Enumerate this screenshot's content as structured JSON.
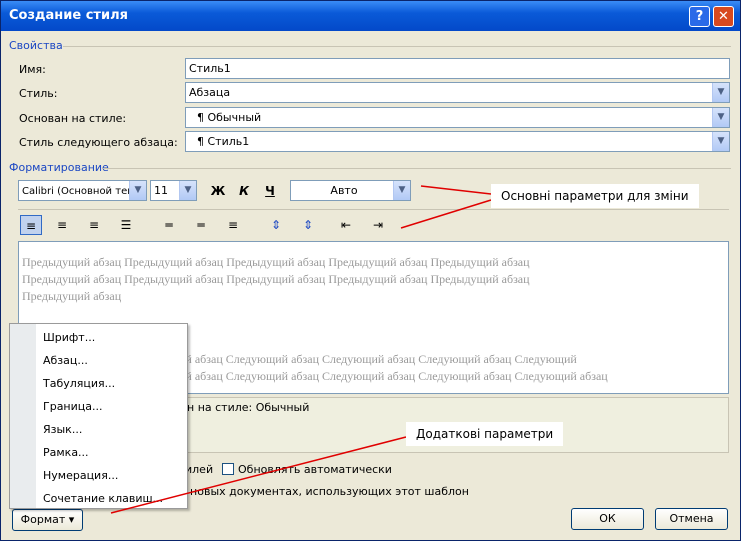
{
  "window": {
    "title": "Создание стиля",
    "help_btn": "?",
    "close_btn": "✕"
  },
  "properties": {
    "section": "Свойства",
    "name_label": "Имя:",
    "name_value": "Стиль1",
    "type_label": "Стиль:",
    "type_value": "Абзаца",
    "based_label": "Основан на стиле:",
    "based_value": "¶ Обычный",
    "next_label": "Стиль следующего абзаца:",
    "next_value": "¶ Стиль1"
  },
  "formatting": {
    "section": "Форматирование",
    "font": "Calibri (Основной текс",
    "size": "11",
    "bold": "Ж",
    "italic": "К",
    "underline": "Ч",
    "color": "Авто"
  },
  "preview": {
    "prev_line1": "Предыдущий абзац Предыдущий абзац Предыдущий абзац Предыдущий абзац Предыдущий абзац",
    "prev_line2": "Предыдущий абзац Предыдущий абзац Предыдущий абзац Предыдущий абзац Предыдущий абзац",
    "prev_line3": "Предыдущий абзац",
    "next_line1": "ий абзац Следующий абзац Следующий абзац Следующий абзац Следующий",
    "next_line2": "ий абзац Следующий абзац Следующий абзац Следующий абзац Следующий абзац"
  },
  "description": {
    "text": "н на стиле: Обычный"
  },
  "options": {
    "add_styles_partial": "илей",
    "auto_update": "Обновлять автоматически",
    "new_docs": "В новых документах, использующих этот шаблон"
  },
  "menu": {
    "items": [
      "Шрифт...",
      "Абзац...",
      "Табуляция...",
      "Граница...",
      "Язык...",
      "Рамка...",
      "Нумерация...",
      "Сочетание клавиш..."
    ]
  },
  "buttons": {
    "format": "Формат ▾",
    "ok": "ОК",
    "cancel": "Отмена"
  },
  "annotations": {
    "main": "Основні параметри для зміни",
    "extra": "Додаткові параметри",
    "color": "#e00000"
  }
}
